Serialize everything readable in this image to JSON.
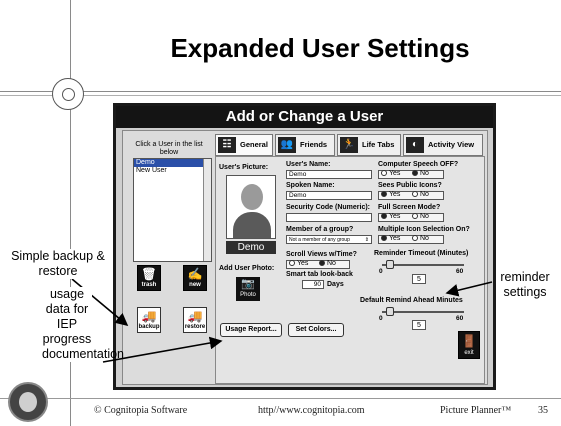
{
  "slide": {
    "title": "Expanded User Settings",
    "footer": {
      "copyright": "© Cognitopia Software",
      "url": "http//www.cognitopia.com",
      "product": "Picture Planner™",
      "page": "35"
    },
    "annotations": {
      "backup": "Simple backup & restore",
      "usage": "usage data for IEP progress documentation",
      "reminder": "reminder settings"
    }
  },
  "app": {
    "title": "Add or Change a User",
    "list_caption": "Click a User in the list below",
    "users": [
      "Demo",
      "New User"
    ],
    "selected_user": "Demo",
    "buttons": {
      "trash": "trash",
      "new": "new",
      "backup": "backup",
      "restore": "restore",
      "photo": "Photo",
      "exit": "exit",
      "usage_report": "Usage Report...",
      "set_colors": "Set Colors..."
    },
    "tabs": [
      "General",
      "Friends",
      "Life Tabs",
      "Activity View"
    ],
    "active_tab": "General",
    "general": {
      "users_picture_label": "User's Picture:",
      "picture_name": "Demo",
      "add_user_photo_label": "Add User Photo:",
      "users_name_label": "User's Name:",
      "users_name_value": "Demo",
      "spoken_name_label": "Spoken Name:",
      "spoken_name_value": "Demo",
      "security_code_label": "Security Code (Numeric):",
      "security_code_value": "",
      "member_group_label": "Member of a group?",
      "member_group_value": "Not a member of any group",
      "scroll_views_label": "Scroll Views w/Time?",
      "scroll_yes": "Yes",
      "scroll_no": "No",
      "scroll_selected": "No",
      "lookback_label": "Smart tab look-back",
      "lookback_value": "90",
      "lookback_unit": "Days",
      "computer_speech_label": "Computer Speech OFF?",
      "computer_speech_selected": "No",
      "public_icons_label": "Sees Public Icons?",
      "public_icons_selected": "Yes",
      "full_screen_label": "Full Screen Mode?",
      "full_screen_selected": "Yes",
      "multi_icon_label": "Multiple Icon Selection On?",
      "multi_icon_selected": "Yes",
      "yes_label": "Yes",
      "no_label": "No",
      "reminder_timeout_label": "Reminder Timeout (Minutes)",
      "reminder_timeout_min": "0",
      "reminder_timeout_max": "60",
      "reminder_timeout_value": "5",
      "remind_ahead_label": "Default Remind Ahead Minutes",
      "remind_ahead_min": "0",
      "remind_ahead_max": "60",
      "remind_ahead_value": "5"
    },
    "icons": {
      "trash": "trash-can-icon",
      "new": "person-new-icon",
      "backup": "truck-icon",
      "restore": "truck-icon",
      "photo": "camera-icon",
      "exit": "exit-door-icon"
    }
  }
}
